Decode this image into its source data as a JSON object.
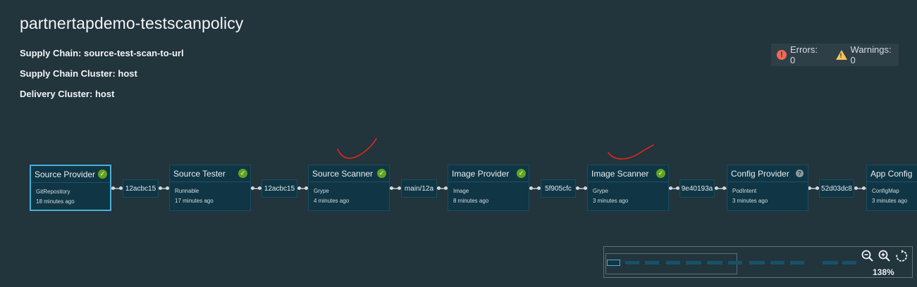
{
  "page": {
    "title": "partnertapdemo-testscanpolicy",
    "supply_chain_label": "Supply Chain:",
    "supply_chain_value": "source-test-scan-to-url",
    "supply_chain_cluster_label": "Supply Chain Cluster:",
    "supply_chain_cluster_value": "host",
    "delivery_cluster_label": "Delivery Cluster:",
    "delivery_cluster_value": "host"
  },
  "status": {
    "errors_label": "Errors: 0",
    "warnings_label": "Warnings: 0",
    "error_color": "#ef6a55",
    "warning_color": "#f5c451"
  },
  "nodes": [
    {
      "title": "Source Provider",
      "kind": "GitRepository",
      "time": "18 minutes ago",
      "status": "success"
    },
    {
      "title": "Source Tester",
      "kind": "Runnable",
      "time": "17 minutes ago",
      "status": "success"
    },
    {
      "title": "Source Scanner",
      "kind": "Grype",
      "time": "4 minutes ago",
      "status": "success"
    },
    {
      "title": "Image Provider",
      "kind": "Image",
      "time": "8 minutes ago",
      "status": "success"
    },
    {
      "title": "Image Scanner",
      "kind": "Grype",
      "time": "3 minutes ago",
      "status": "success"
    },
    {
      "title": "Config Provider",
      "kind": "PodIntent",
      "time": "3 minutes ago",
      "status": "unknown"
    },
    {
      "title": "App Config",
      "kind": "ConfigMap",
      "time": "3 minutes ago",
      "status": "success"
    }
  ],
  "connectors": [
    {
      "label": "12acbc15"
    },
    {
      "label": "12acbc15"
    },
    {
      "label": "main/12a"
    },
    {
      "label": "5f905cfc"
    },
    {
      "label": "9e40193a"
    },
    {
      "label": "52d03dc8"
    }
  ],
  "icons": {
    "success": "check-circle-icon",
    "unknown": "help-circle-icon",
    "error": "exclamation-circle-icon",
    "warning": "warning-triangle-icon"
  },
  "colors": {
    "background": "#22343c",
    "node_fill": "#103645",
    "selected_border": "#49afd9",
    "success": "#62a420",
    "annotation": "#e0281c"
  },
  "zoom": {
    "level": "138%"
  }
}
